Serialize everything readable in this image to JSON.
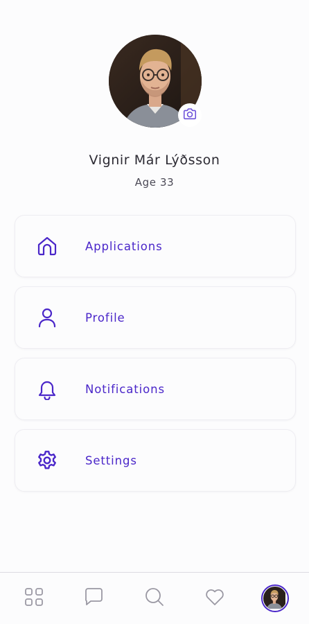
{
  "profile": {
    "name": "Vignir Már Lýðsson",
    "age_label": "Age 33",
    "avatar_icon": "user-photo",
    "camera_icon": "camera-icon"
  },
  "menu": {
    "items": [
      {
        "label": "Applications",
        "icon": "home-icon"
      },
      {
        "label": "Profile",
        "icon": "user-icon"
      },
      {
        "label": "Notifications",
        "icon": "bell-icon"
      },
      {
        "label": "Settings",
        "icon": "gear-icon"
      }
    ]
  },
  "bottom_nav": {
    "items": [
      {
        "icon": "grid-icon"
      },
      {
        "icon": "chat-icon"
      },
      {
        "icon": "search-icon"
      },
      {
        "icon": "heart-icon"
      },
      {
        "icon": "profile-avatar"
      }
    ],
    "active_index": 4
  },
  "colors": {
    "accent": "#4a26c9",
    "text_primary": "#2c2a33",
    "text_secondary": "#4b4956",
    "nav_icon": "#9a98a3",
    "background": "#fcfcfd"
  }
}
